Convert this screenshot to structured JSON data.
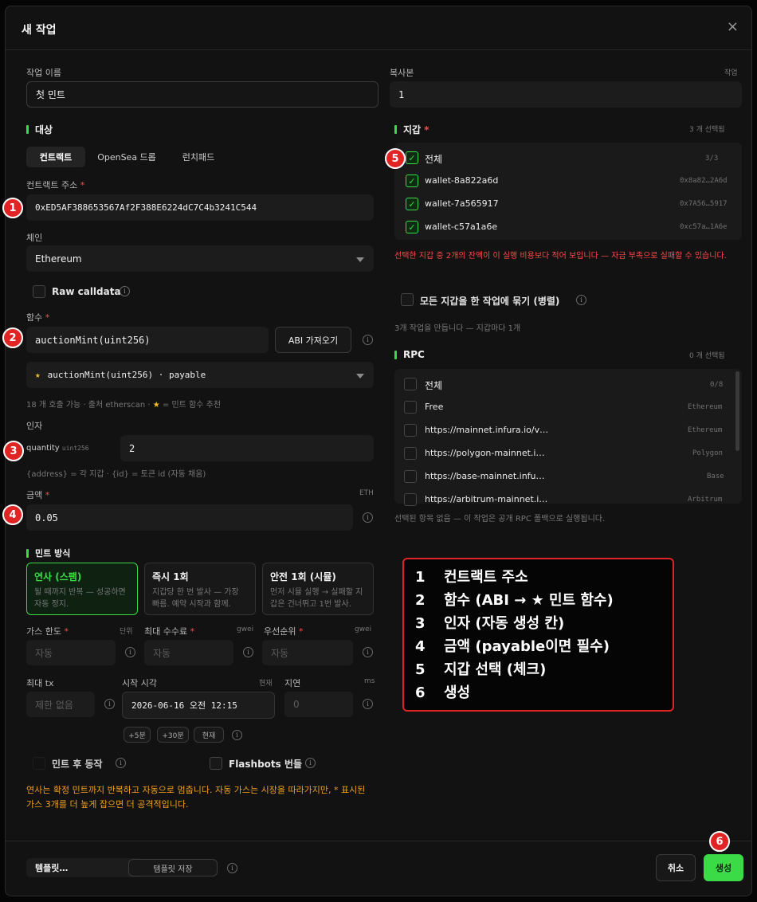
{
  "title": "새 작업",
  "job_name": {
    "label": "작업 이름",
    "value": "첫 민트"
  },
  "copies": {
    "label": "복사본",
    "unit": "작업",
    "value": "1"
  },
  "target": {
    "section": "대상",
    "tabs": [
      "컨트랙트",
      "OpenSea 드롭",
      "런치패드"
    ],
    "contract_label": "컨트랙트 주소",
    "contract_value": "0xED5AF388653567Af2F388E6224dC7C4b3241C544",
    "chain_label": "체인",
    "chain_value": "Ethereum",
    "raw_calldata": "Raw calldata",
    "function_label": "함수",
    "function_value": "auctionMint(uint256)",
    "abi_button": "ABI 가져오기",
    "function_select": "auctionMint(uint256) · payable",
    "function_hint_pre": "18 개 호출 가능 · 출처 etherscan · ",
    "function_hint_post": " = 민트 함수 추천",
    "args_label": "인자",
    "arg_name": "quantity",
    "arg_type": "uint256",
    "arg_value": "2",
    "args_hint": "{address} = 각 지갑 · {id} = 토큰 id (자동 채움)",
    "amount_label": "금액",
    "amount_unit": "ETH",
    "amount_value": "0.05"
  },
  "mint": {
    "section": "민트 방식",
    "modes": [
      {
        "title": "연사 (스팸)",
        "desc": "될 때까지 반복 — 성공하면 자동 정지."
      },
      {
        "title": "즉시 1회",
        "desc": "지갑당 한 번 발사 — 가장 빠름. 예약 시작과 함께."
      },
      {
        "title": "안전 1회 (시뮬)",
        "desc": "먼저 시뮬 실행 → 실패할 지갑은 건너뛰고 1번 발사."
      }
    ],
    "gas_limit": {
      "label": "가스 한도",
      "unit": "단위",
      "placeholder": "자동"
    },
    "max_fee": {
      "label": "최대 수수료",
      "unit": "gwei",
      "placeholder": "자동"
    },
    "priority": {
      "label": "우선순위",
      "unit": "gwei",
      "placeholder": "자동"
    },
    "max_tx": {
      "label": "최대 tx",
      "placeholder": "제한 없음"
    },
    "start_time": {
      "label": "시작 시각",
      "now": "현재",
      "value": "2026-06-16 오전 12:15"
    },
    "delay": {
      "label": "지연",
      "unit": "ms",
      "placeholder": "0"
    },
    "chips": [
      "+5분",
      "+30분",
      "현재"
    ],
    "after_mint": "민트 후 동작",
    "flashbots": "Flashbots 번들",
    "warning": "연사는 확정 민트까지 반복하고 자동으로 멈춥니다. 자동 가스는 시장을 따라가지만, * 표시된 가스 3개를 더 높게 잡으면 더 공격적입니다."
  },
  "wallets": {
    "section": "지갑",
    "selected": "3 개 선택됨",
    "all_label": "전체",
    "count": "3/3",
    "items": [
      {
        "name": "wallet-8a822a6d",
        "addr": "0x8a82…2A6d"
      },
      {
        "name": "wallet-7a565917",
        "addr": "0x7A56…5917"
      },
      {
        "name": "wallet-c57a1a6e",
        "addr": "0xc57a…1A6e"
      }
    ],
    "warning": "선택한 지갑 중 2개의 잔액이 이 실행 비용보다 적어 보입니다 — 자금 부족으로 실패할 수 있습니다.",
    "bundle": "모든 지갑을 한 작업에 묶기 (병렬)",
    "bundle_hint": "3개 작업을 만듭니다 — 지갑마다 1개"
  },
  "rpc": {
    "section": "RPC",
    "selected": "0 개 선택됨",
    "all_label": "전체",
    "count": "0/8",
    "items": [
      {
        "name": "Free",
        "chain": "Ethereum"
      },
      {
        "name": "https://mainnet.infura.io/v…",
        "chain": "Ethereum"
      },
      {
        "name": "https://polygon-mainnet.i…",
        "chain": "Polygon"
      },
      {
        "name": "https://base-mainnet.infu…",
        "chain": "Base"
      },
      {
        "name": "https://arbitrum-mainnet.i…",
        "chain": "Arbitrum"
      }
    ],
    "hint": "선택된 항목 없음 — 이 작업은 공개 RPC 폴백으로 실행됩니다."
  },
  "footer": {
    "template": "템플릿…",
    "save_template": "템플릿 저장",
    "cancel": "취소",
    "create": "생성"
  },
  "badges": [
    "1",
    "2",
    "3",
    "4",
    "5",
    "6"
  ],
  "legend": [
    {
      "n": "1",
      "text": "컨트랙트 주소"
    },
    {
      "n": "2",
      "text": "함수 (ABI → ★ 민트 함수)"
    },
    {
      "n": "3",
      "text": "인자 (자동 생성 칸)"
    },
    {
      "n": "4",
      "text": "금액 (payable이면 필수)"
    },
    {
      "n": "5",
      "text": "지갑 선택 (체크)"
    },
    {
      "n": "6",
      "text": "생성"
    }
  ],
  "colors": {
    "accent": "#3adb46",
    "danger": "#e02424",
    "warning": "#f0a020"
  }
}
